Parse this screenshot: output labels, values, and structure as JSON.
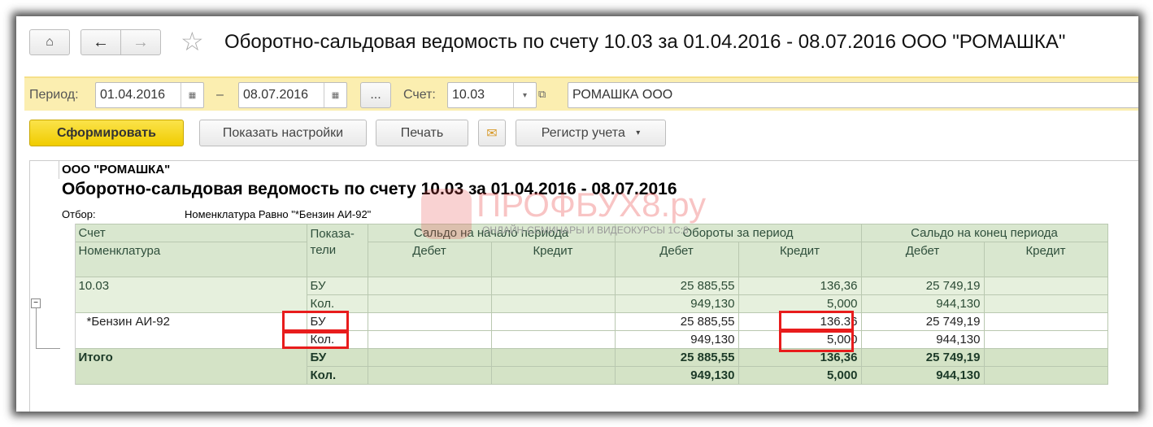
{
  "window": {
    "title": "Оборотно-сальдовая ведомость по счету 10.03 за 01.04.2016 - 08.07.2016 ООО \"РОМАШКА\""
  },
  "filters": {
    "period_label": "Период:",
    "date_from": "01.04.2016",
    "dash": "–",
    "date_to": "08.07.2016",
    "more": "...",
    "account_label": "Счет:",
    "account": "10.03",
    "organization": "РОМАШКА ООО"
  },
  "toolbar": {
    "generate": "Сформировать",
    "settings": "Показать настройки",
    "print": "Печать",
    "register": "Регистр учета"
  },
  "report": {
    "org": "ООО \"РОМАШКА\"",
    "heading": "Оборотно-сальдовая ведомость по счету 10.03 за 01.04.2016 - 08.07.2016",
    "filter_label": "Отбор:",
    "filter_value": "Номенклатура Равно \"*Бензин АИ-92\"",
    "headers": {
      "account": "Счет",
      "item": "Номенклатура",
      "indicators": "Показа-\nтели",
      "opening": "Сальдо на начало периода",
      "turnover": "Обороты за период",
      "closing": "Сальдо на конец периода",
      "debit": "Дебет",
      "credit": "Кредит"
    },
    "rows": [
      {
        "kind": "g",
        "name": "10.03",
        "lines": [
          [
            "БУ",
            "",
            "",
            "25 885,55",
            "136,36",
            "25 749,19",
            ""
          ],
          [
            "Кол.",
            "",
            "",
            "949,130",
            "5,000",
            "944,130",
            ""
          ]
        ]
      },
      {
        "kind": "w",
        "name": "*Бензин АИ-92",
        "lines": [
          [
            "БУ",
            "",
            "",
            "25 885,55",
            "136.36",
            "25 749,19",
            ""
          ],
          [
            "Кол.",
            "",
            "",
            "949,130",
            "5,000",
            "944,130",
            ""
          ]
        ]
      },
      {
        "kind": "t",
        "name": "Итого",
        "lines": [
          [
            "БУ",
            "",
            "",
            "25 885,55",
            "136,36",
            "25 749,19",
            ""
          ],
          [
            "Кол.",
            "",
            "",
            "949,130",
            "5,000",
            "944,130",
            ""
          ]
        ]
      }
    ]
  },
  "watermark": {
    "brand": "ПРОФБУХ8.ру",
    "tagline": "ОНЛАЙН-СЕМИНАРЫ И ВИДЕОКУРСЫ 1С:8"
  }
}
